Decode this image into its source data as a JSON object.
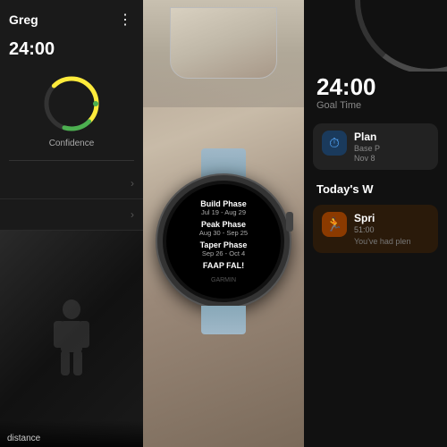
{
  "left": {
    "header_name": "Greg",
    "time": "24:00",
    "confidence_label": "Confidence",
    "menu_dots": "⋮",
    "list_items": [
      {
        "label": "",
        "has_chevron": true
      },
      {
        "label": "",
        "has_chevron": true
      }
    ],
    "image_label": "distance"
  },
  "middle": {
    "phases": [
      {
        "name": "Build Phase",
        "date": "Jul 19 - Aug 29"
      },
      {
        "name": "Peak Phase",
        "date": "Aug 30 - Sep 25"
      },
      {
        "name": "Taper Phase",
        "date": "Sep 26 - Oct 4"
      },
      {
        "name": "FAAP FAL!",
        "date": ""
      }
    ],
    "brand": "GARMIN"
  },
  "right": {
    "time": "24:00",
    "goal_label": "Goal Time",
    "plan_card": {
      "title": "Plan",
      "sub1": "Base P",
      "sub2": "Nov 8"
    },
    "todays_workout_header": "Today's W",
    "sprint_card": {
      "title": "Spri",
      "time": "51:00",
      "sub": "You've had plen"
    }
  },
  "colors": {
    "accent_green": "#4caf50",
    "accent_yellow": "#ffeb3b",
    "accent_orange": "#ff9800",
    "arc_color": "#555",
    "blue_icon": "#1a6aaa",
    "orange_icon": "#e65c00"
  }
}
